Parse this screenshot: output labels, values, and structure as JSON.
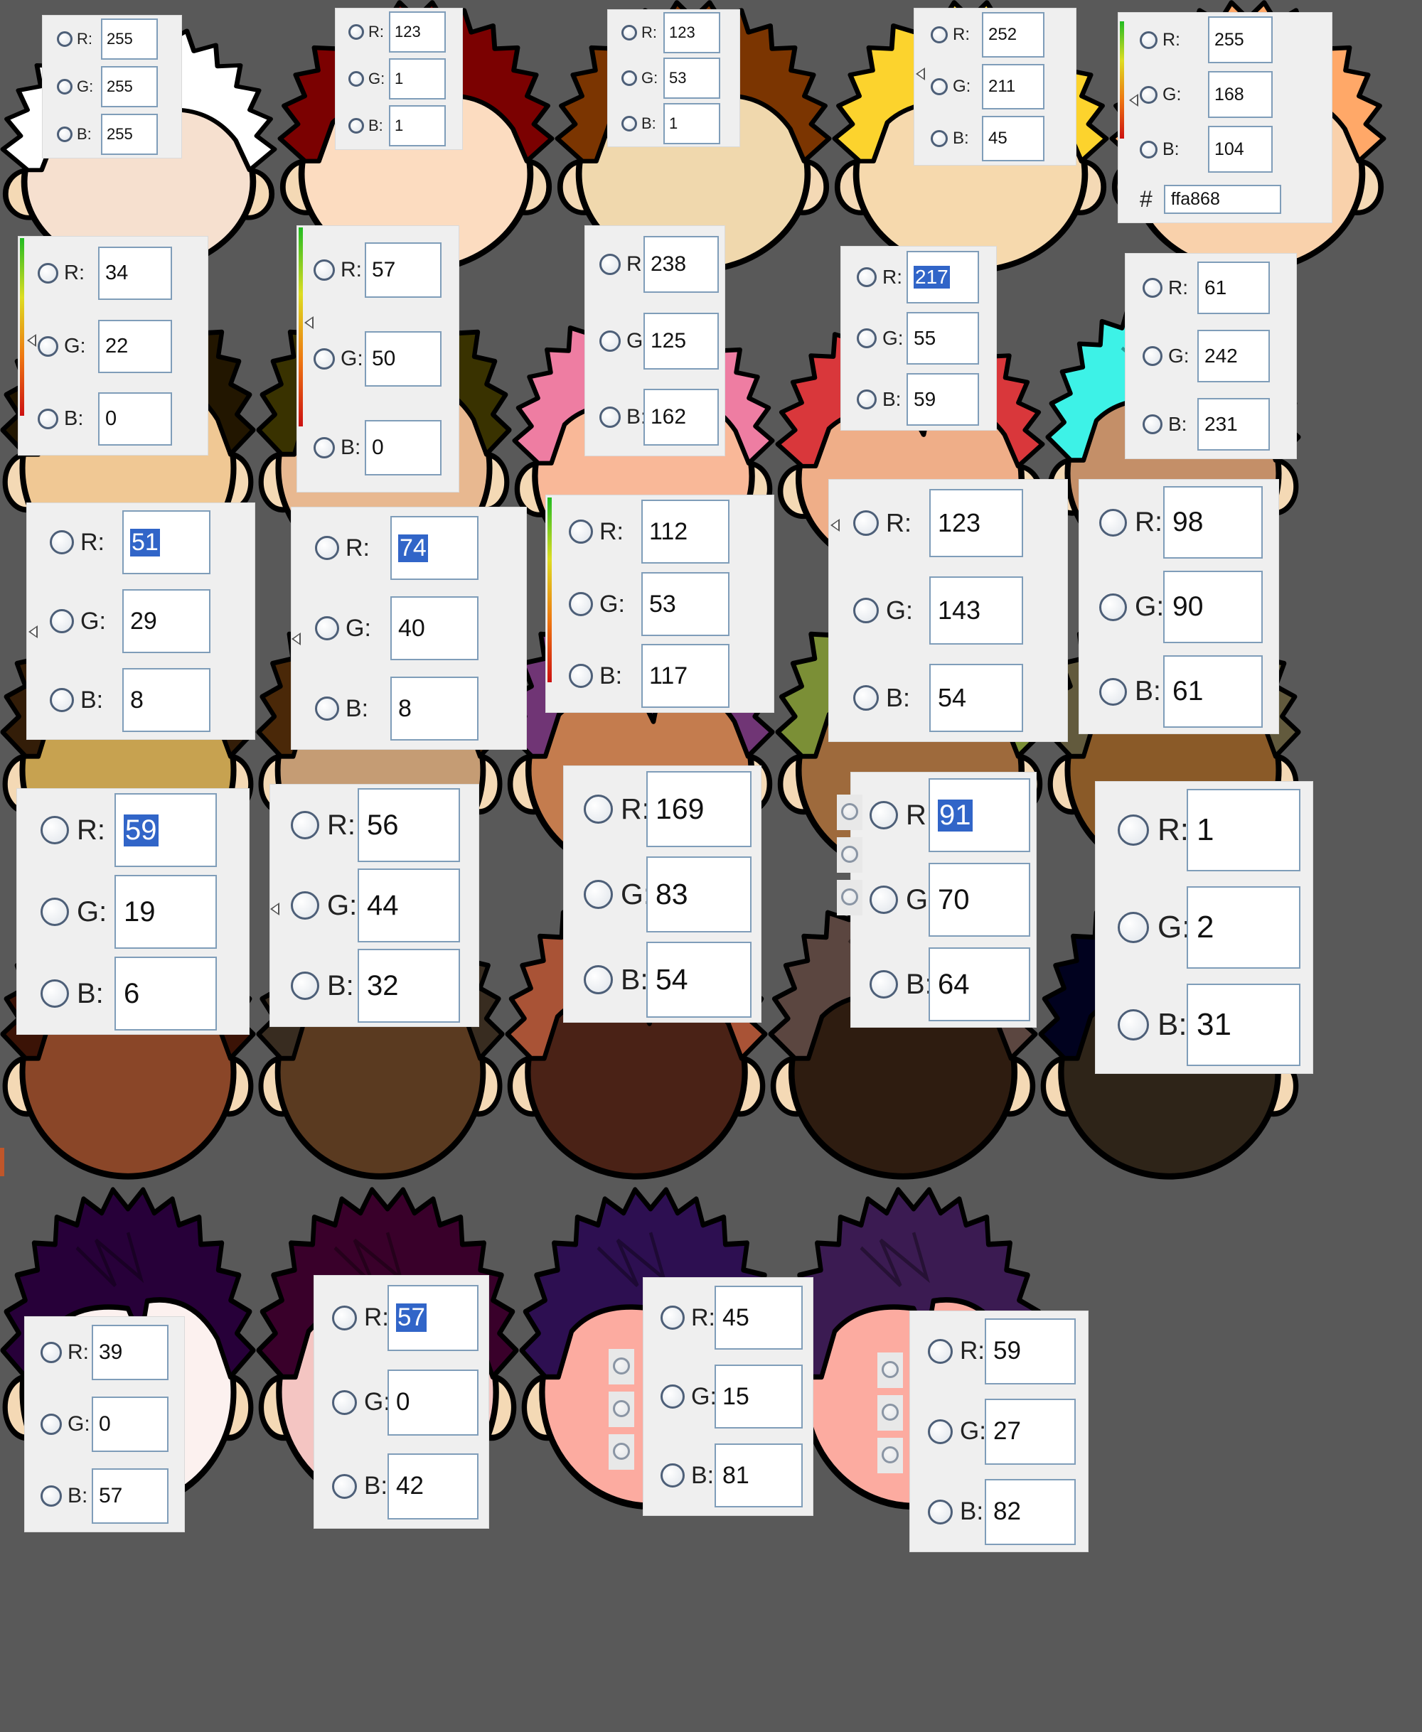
{
  "colors": {
    "background": "#595959",
    "panel": "#efefef",
    "field_border": "#7f9db9",
    "selection": "#3165c8",
    "outline": "#000000",
    "ear": "#f4d9b5"
  },
  "labels": {
    "r": "R:",
    "g": "G:",
    "b": "B:",
    "hash": "#"
  },
  "swatches": [
    {
      "r": "255",
      "g": "255",
      "b": "255",
      "hair": "#ffffff",
      "skin": "#f6e0cf",
      "selected": ""
    },
    {
      "r": "123",
      "g": "1",
      "b": "1",
      "hair": "#7b0101",
      "skin": "#fcdcc0",
      "selected": ""
    },
    {
      "r": "123",
      "g": "53",
      "b": "1",
      "hair": "#7b3501",
      "skin": "#f0d8ad",
      "selected": ""
    },
    {
      "r": "252",
      "g": "211",
      "b": "45",
      "hair": "#fcd32d",
      "skin": "#f6d9ad",
      "selected": ""
    },
    {
      "r": "255",
      "g": "168",
      "b": "104",
      "hair": "#ffa868",
      "skin": "#f9d1ab",
      "selected": "",
      "hex": "ffa868"
    },
    {
      "r": "34",
      "g": "22",
      "b": "0",
      "hair": "#221600",
      "skin": "#f0c894",
      "selected": ""
    },
    {
      "r": "57",
      "g": "50",
      "b": "0",
      "hair": "#393200",
      "skin": "#e8b890",
      "selected": ""
    },
    {
      "r": "238",
      "g": "125",
      "b": "162",
      "hair": "#ee7da2",
      "skin": "#f9b898",
      "selected": ""
    },
    {
      "r": "217",
      "g": "55",
      "b": "59",
      "hair": "#d9373b",
      "skin": "#efae88",
      "selected": "r"
    },
    {
      "r": "61",
      "g": "242",
      "b": "231",
      "hair": "#3df2e7",
      "skin": "#c48f68",
      "selected": ""
    },
    {
      "r": "51",
      "g": "29",
      "b": "8",
      "hair": "#331d08",
      "skin": "#c7a250",
      "selected": "r"
    },
    {
      "r": "74",
      "g": "40",
      "b": "8",
      "hair": "#4a2808",
      "skin": "#c59c74",
      "selected": "r"
    },
    {
      "r": "112",
      "g": "53",
      "b": "117",
      "hair": "#703575",
      "skin": "#c47c4e",
      "selected": ""
    },
    {
      "r": "123",
      "g": "143",
      "b": "54",
      "hair": "#7b8f36",
      "skin": "#9e6a3c",
      "selected": ""
    },
    {
      "r": "98",
      "g": "90",
      "b": "61",
      "hair": "#625a3d",
      "skin": "#8a5a28",
      "selected": ""
    },
    {
      "r": "59",
      "g": "19",
      "b": "6",
      "hair": "#3b1306",
      "skin": "#8a4628",
      "selected": "r"
    },
    {
      "r": "56",
      "g": "44",
      "b": "32",
      "hair": "#382c20",
      "skin": "#5a3a20",
      "selected": ""
    },
    {
      "r": "169",
      "g": "83",
      "b": "54",
      "hair": "#a95336",
      "skin": "#4a2216",
      "selected": ""
    },
    {
      "r": "91",
      "g": "70",
      "b": "64",
      "hair": "#5b4640",
      "skin": "#2e1c10",
      "selected": "r"
    },
    {
      "r": "1",
      "g": "2",
      "b": "31",
      "hair": "#01021f",
      "skin": "#2e2418",
      "selected": ""
    },
    {
      "r": "39",
      "g": "0",
      "b": "57",
      "hair": "#270039",
      "skin": "#fcf1ef",
      "selected": ""
    },
    {
      "r": "57",
      "g": "0",
      "b": "42",
      "hair": "#39002a",
      "skin": "#f4c5c2",
      "selected": "r"
    },
    {
      "r": "45",
      "g": "15",
      "b": "81",
      "hair": "#2d0f51",
      "skin": "#fcaba0",
      "selected": ""
    },
    {
      "r": "59",
      "g": "27",
      "b": "82",
      "hair": "#3b1b52",
      "skin": "#fcaba0",
      "selected": ""
    }
  ]
}
